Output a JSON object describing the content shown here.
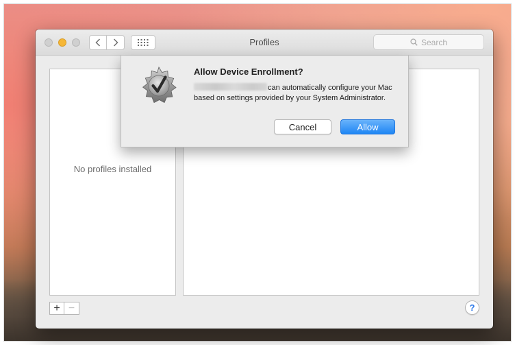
{
  "window": {
    "title": "Profiles",
    "nav": {
      "back_icon": "chevron-left-icon",
      "forward_icon": "chevron-right-icon",
      "grid_icon": "grid-icon"
    },
    "search": {
      "placeholder": "Search"
    }
  },
  "profiles": {
    "empty_message": "No profiles installed",
    "add_label": "+",
    "remove_label": "−",
    "help_label": "?"
  },
  "dialog": {
    "title": "Allow Device Enrollment?",
    "body": "can automatically configure your Mac based on settings provided by your System Administrator.",
    "cancel_label": "Cancel",
    "allow_label": "Allow",
    "badge_icon": "checkmark-seal-icon"
  },
  "colors": {
    "accent": "#1f86f4",
    "minimize": "#f6b737",
    "help": "#2f7be9"
  }
}
